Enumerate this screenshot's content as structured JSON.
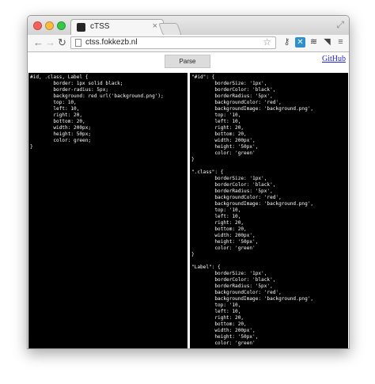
{
  "browser": {
    "tab_title": "cTSS",
    "tab_close": "×",
    "url": "ctss.fokkezb.nl",
    "nav": {
      "back": "←",
      "forward": "→",
      "reload": "↻"
    },
    "icons": {
      "star": "☆",
      "key": "⚷",
      "blue_ext": "✕",
      "stack": "≋",
      "pocket": "◥",
      "menu": "≡",
      "fullscreen": "⤢"
    },
    "traffic_colors": {
      "close": "#fc605b",
      "minimize": "#fdbc40",
      "maximize": "#34c84a"
    }
  },
  "page": {
    "parse_label": "Parse",
    "github_label": "GitHub",
    "input_code": "#id, .class, Label {\n\tborder: 1px solid black;\n\tborder-radius: 5px;\n\tbackground: red url('background.png');\n\ttop: 10,\n\tleft: 10,\n\tright: 20,\n\tbottom: 20,\n\twidth: 200px;\n\theight: 50px;\n\tcolor: green;\n}",
    "output_code": "\"#id\": {\n\tborderSize: '1px',\n\tborderColor: 'black',\n\tborderRadius: '5px',\n\tbackgroundColor: 'red',\n\tbackgroundImage: 'background.png',\n\ttop: '10,\n\tleft: 10,\n\tright: 20,\n\tbottom: 20,\n\twidth: 200px',\n\theight: '50px',\n\tcolor: 'green'\n}\n\n\".class\": {\n\tborderSize: '1px',\n\tborderColor: 'black',\n\tborderRadius: '5px',\n\tbackgroundColor: 'red',\n\tbackgroundImage: 'background.png',\n\ttop: '10,\n\tleft: 10,\n\tright: 20,\n\tbottom: 20,\n\twidth: 200px',\n\theight: '50px',\n\tcolor: 'green'\n}\n\n\"Label\": {\n\tborderSize: '1px',\n\tborderColor: 'black',\n\tborderRadius: '5px',\n\tbackgroundColor: 'red',\n\tbackgroundImage: 'background.png',\n\ttop: '10,\n\tleft: 10,\n\tright: 20,\n\tbottom: 20,\n\twidth: 200px',\n\theight: '50px',\n\tcolor: 'green'"
  }
}
